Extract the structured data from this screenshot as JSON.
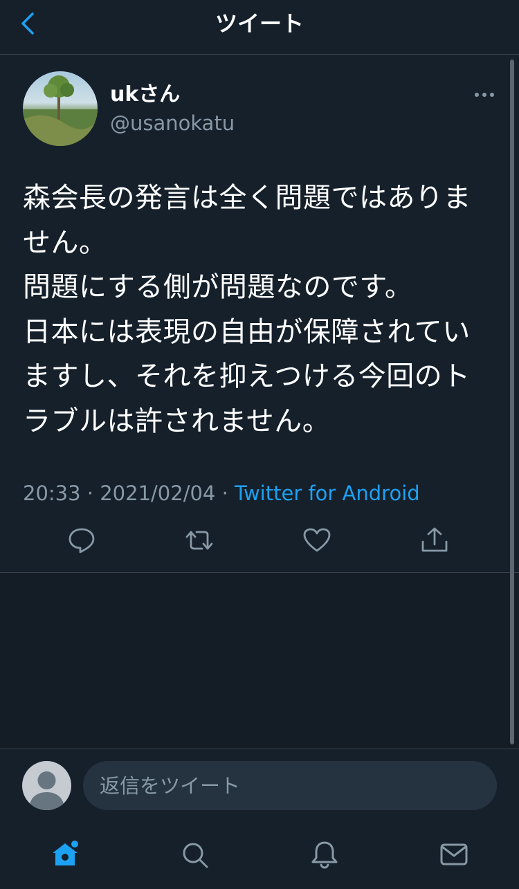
{
  "header": {
    "title": "ツイート"
  },
  "tweet": {
    "display_name": "ukさん",
    "handle": "@usanokatu",
    "text": "森会長の発言は全く問題ではありません。\n問題にする側が問題なのです。\n日本には表現の自由が保障されていますし、それを抑えつける今回のトラブルは許されません。",
    "time": "20:33",
    "date": "2021/02/04",
    "separator": " · ",
    "source": "Twitter for Android"
  },
  "actions": [
    "reply-icon",
    "retweet-icon",
    "like-icon",
    "share-icon"
  ],
  "reply": {
    "placeholder": "返信をツイート"
  },
  "tabs": [
    "home-icon",
    "search-icon",
    "notifications-icon",
    "messages-icon"
  ],
  "colors": {
    "accent": "#1da1f2",
    "background": "#15202b",
    "muted": "#8899a6"
  }
}
